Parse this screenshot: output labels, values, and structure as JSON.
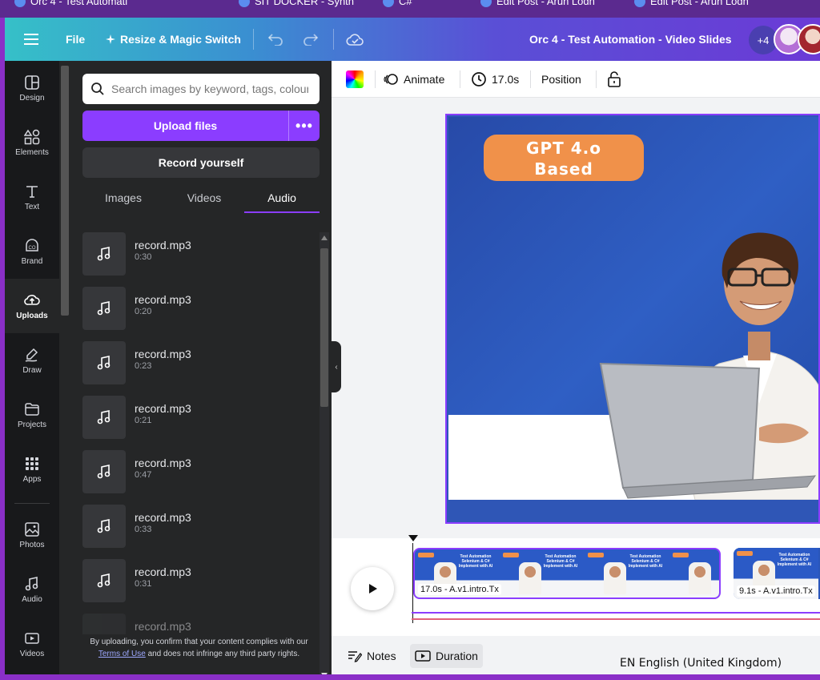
{
  "browser_tabs": [
    {
      "label": "Orc 4 - Test Automati"
    },
    {
      "label": "SIT DOCKER - Synth"
    },
    {
      "label": "C#"
    },
    {
      "label": "Edit Post - Arun Lodh"
    },
    {
      "label": "Edit Post - Arun Lodh"
    }
  ],
  "topbar": {
    "menu_icon": "hamburger-icon",
    "file_label": "File",
    "resize_label": "Resize & Magic Switch",
    "undo_icon": "undo-icon",
    "redo_icon": "redo-icon",
    "cloud_icon": "cloud-saved-icon",
    "doc_title": "Orc 4 - Test Automation - Video Slides",
    "collaborators_extra": "+4"
  },
  "rail": [
    {
      "label": "Design",
      "icon": "design-icon"
    },
    {
      "label": "Elements",
      "icon": "elements-icon"
    },
    {
      "label": "Text",
      "icon": "text-icon"
    },
    {
      "label": "Brand",
      "icon": "brand-icon"
    },
    {
      "label": "Uploads",
      "icon": "upload-cloud-icon",
      "active": true
    },
    {
      "label": "Draw",
      "icon": "draw-icon"
    },
    {
      "label": "Projects",
      "icon": "folder-icon"
    },
    {
      "label": "Apps",
      "icon": "apps-grid-icon"
    },
    {
      "label": "Photos",
      "icon": "photo-icon"
    },
    {
      "label": "Audio",
      "icon": "music-note-icon"
    },
    {
      "label": "Videos",
      "icon": "video-icon"
    }
  ],
  "uploads": {
    "search_placeholder": "Search images by keyword, tags, colour",
    "upload_label": "Upload files",
    "more_label": "•••",
    "record_label": "Record yourself",
    "tabs": [
      {
        "label": "Images"
      },
      {
        "label": "Videos"
      },
      {
        "label": "Audio",
        "active": true
      }
    ],
    "audio_items": [
      {
        "name": "record.mp3",
        "duration": "0:30"
      },
      {
        "name": "record.mp3",
        "duration": "0:20"
      },
      {
        "name": "record.mp3",
        "duration": "0:23"
      },
      {
        "name": "record.mp3",
        "duration": "0:21"
      },
      {
        "name": "record.mp3",
        "duration": "0:47"
      },
      {
        "name": "record.mp3",
        "duration": "0:33"
      },
      {
        "name": "record.mp3",
        "duration": "0:31"
      },
      {
        "name": "record.mp3",
        "duration": ""
      }
    ],
    "footnote_pre": "By uploading, you confirm that your content complies with our",
    "footnote_link": "Terms of Use",
    "footnote_post": "and does not infringe any third party rights."
  },
  "context_toolbar": {
    "color_icon": "color-swatch-icon",
    "animate_label": "Animate",
    "duration_label": "17.0s",
    "position_label": "Position",
    "lock_icon": "lock-icon"
  },
  "slide": {
    "badge_line1": "GPT 4.o",
    "badge_line2": "Based"
  },
  "timeline": {
    "clip1_label": "17.0s - A.v1.intro.Tx",
    "clip2_label": "9.1s - A.v1.intro.Tx",
    "thumb_text": "Test Automation Selenium & C# Implement with AI"
  },
  "bottombar": {
    "notes_label": "Notes",
    "duration_label": "Duration",
    "language": "EN English (United Kingdom)"
  },
  "colors": {
    "accent": "#8b3dff",
    "badge": "#f0914a",
    "slide_blue": "#2f5fc4"
  }
}
